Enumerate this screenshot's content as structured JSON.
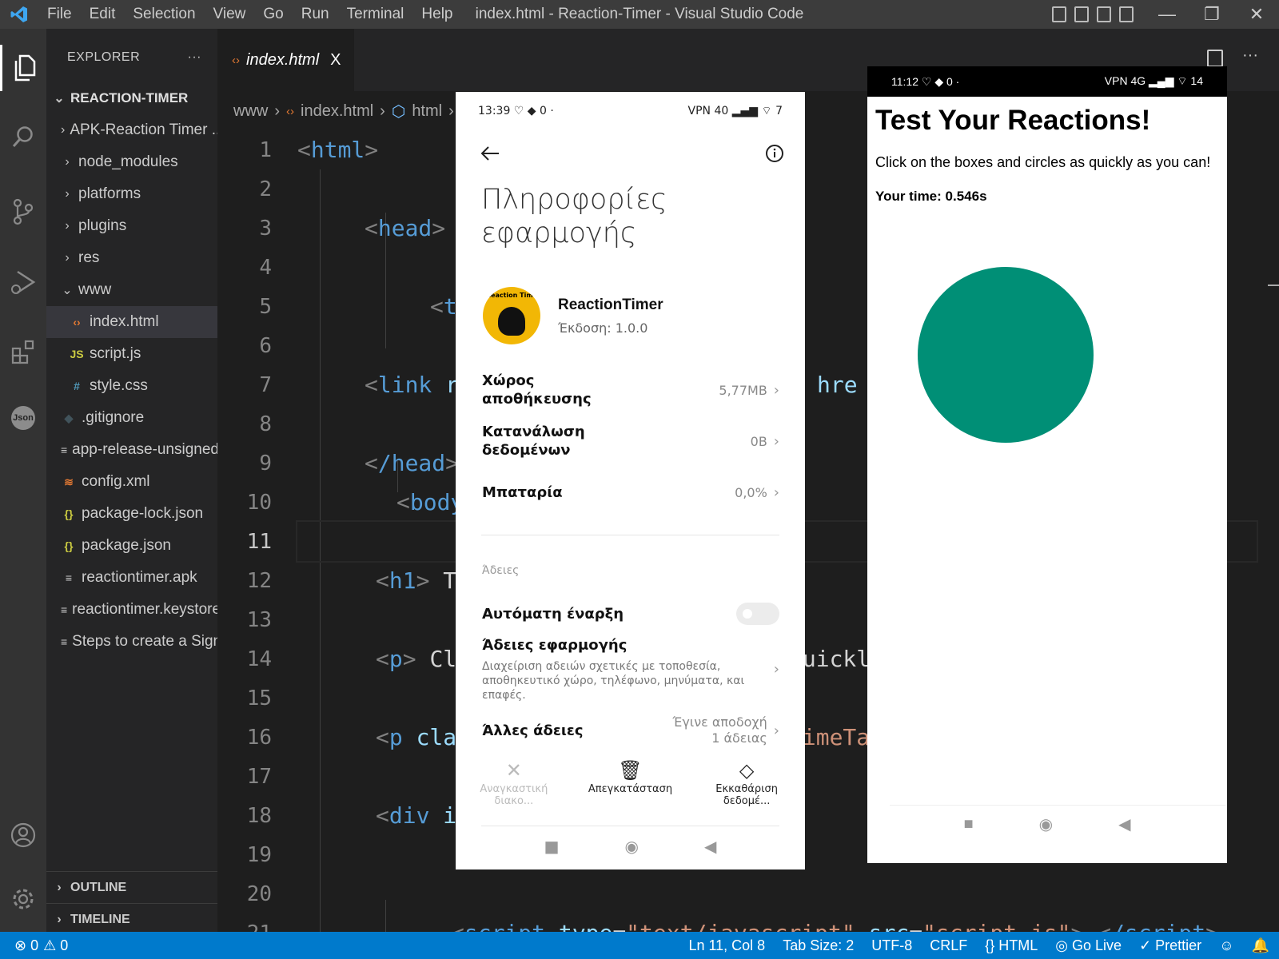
{
  "window": {
    "title": "index.html - Reaction-Timer - Visual Studio Code",
    "menu": [
      "File",
      "Edit",
      "Selection",
      "View",
      "Go",
      "Run",
      "Terminal",
      "Help"
    ]
  },
  "explorer": {
    "header": "EXPLORER",
    "more": "···",
    "project": "REACTION-TIMER",
    "items": [
      {
        "label": "APK-Reaction Timer ...",
        "type": "folder",
        "depth": 0,
        "chevron": "›"
      },
      {
        "label": "node_modules",
        "type": "folder",
        "depth": 0,
        "chevron": "›"
      },
      {
        "label": "platforms",
        "type": "folder",
        "depth": 0,
        "chevron": "›"
      },
      {
        "label": "plugins",
        "type": "folder",
        "depth": 0,
        "chevron": "›"
      },
      {
        "label": "res",
        "type": "folder",
        "depth": 0,
        "chevron": "›"
      },
      {
        "label": "www",
        "type": "folder",
        "depth": 0,
        "chevron": "⌄"
      },
      {
        "label": "index.html",
        "type": "html",
        "depth": 1,
        "icon": "‹›"
      },
      {
        "label": "script.js",
        "type": "js",
        "depth": 1,
        "icon": "JS"
      },
      {
        "label": "style.css",
        "type": "css",
        "depth": 1,
        "icon": "#"
      },
      {
        "label": ".gitignore",
        "type": "git",
        "depth": 0,
        "icon": "◆"
      },
      {
        "label": "app-release-unsigned...",
        "type": "file",
        "depth": 0,
        "icon": "≡"
      },
      {
        "label": "config.xml",
        "type": "xml",
        "depth": 0,
        "icon": "≋"
      },
      {
        "label": "package-lock.json",
        "type": "json",
        "depth": 0,
        "icon": "{}"
      },
      {
        "label": "package.json",
        "type": "json",
        "depth": 0,
        "icon": "{}"
      },
      {
        "label": "reactiontimer.apk",
        "type": "file",
        "depth": 0,
        "icon": "≡"
      },
      {
        "label": "reactiontimer.keystore",
        "type": "file",
        "depth": 0,
        "icon": "≡"
      },
      {
        "label": "Steps to create a Sign...",
        "type": "file",
        "depth": 0,
        "icon": "≡"
      }
    ],
    "outline": "OUTLINE",
    "timeline": "TIMELINE"
  },
  "editor": {
    "tab_label": "index.html",
    "tab_close": "X",
    "breadcrumb": [
      "www",
      "›",
      "index.html",
      "›",
      "html",
      "›"
    ],
    "line_numbers": [
      "1",
      "2",
      "3",
      "4",
      "5",
      "6",
      "7",
      "8",
      "9",
      "10",
      "11",
      "12",
      "13",
      "14",
      "15",
      "16",
      "17",
      "18",
      "19",
      "20",
      "21"
    ],
    "current_line": "11",
    "code": {
      "l1_tag": "html",
      "l3_tag": "head",
      "l5_tag": "t",
      "l7_tag": "link",
      "l7_attr": "re",
      "l7_href": "hre",
      "l9_tag": "/head",
      "l10_tag": "body",
      "l12_tag": "h1",
      "l12_text": "Te",
      "l14_tag": "p",
      "l14_text": "Cli",
      "l14_tail": "quickl",
      "l16_tag": "p",
      "l16_attr": "clas",
      "l16_tail": "timeTa",
      "l18_tag": "div",
      "l18_attr": "id",
      "l21_tag": "script",
      "l21_attr1": "type",
      "l21_val1": "\"text/javascript\"",
      "l21_attr2": "src",
      "l21_val2": "\"script.js\"",
      "l21_close": "/script"
    }
  },
  "statusbar": {
    "errors": "⊗ 0",
    "warnings": "⚠ 0",
    "position": "Ln 11, Col 8",
    "tab_size": "Tab Size: 2",
    "encoding": "UTF-8",
    "eol": "CRLF",
    "language": "{} HTML",
    "go_live": "Go Live",
    "prettier": "✓ Prettier"
  },
  "phone1": {
    "status_time": "13:39",
    "status_kb": "0",
    "status_right": "VPN  40 ▂▄▆  ⌔  7",
    "title": "Πληροφορίες εφαρμογής",
    "app_logo_text": "Reaction Time",
    "app_name": "ReactionTimer",
    "version": "Έκδοση: 1.0.0",
    "storage_label": "Χώρος αποθήκευσης",
    "storage_value": "5,77MB",
    "data_label": "Κατανάλωση δεδομένων",
    "data_value": "0B",
    "battery_label": "Μπαταρία",
    "battery_value": "0,0%",
    "permissions_section": "Άδειες",
    "autostart_label": "Αυτόματη έναρξη",
    "app_perms_label": "Άδειες εφαρμογής",
    "app_perms_desc": "Διαχείριση αδειών σχετικές με τοποθεσία, αποθηκευτικό χώρο, τηλέφωνο, μηνύματα, και επαφές.",
    "other_perms_label": "Άλλες άδειες",
    "other_perms_value": "Έγινε αποδοχή 1 άδειας",
    "force_stop": "Αναγκαστική διακο...",
    "uninstall": "Απεγκατάσταση",
    "clear_data": "Εκκαθάριση δεδομέ..."
  },
  "phone2": {
    "status_time": "11:12",
    "status_kb": "0",
    "status_right": "VPN 4G ▂▄▆  ⌔  14",
    "heading": "Test Your Reactions!",
    "paragraph": "Click on the boxes and circles as quickly as you can!",
    "time": "Your time: 0.546s",
    "shape_color": "#008f76"
  }
}
